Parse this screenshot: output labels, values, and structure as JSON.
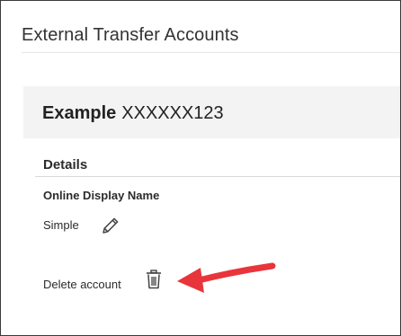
{
  "page": {
    "title": "External Transfer Accounts"
  },
  "account": {
    "name": "Example",
    "masked_number": "XXXXXX123"
  },
  "details": {
    "section_title": "Details",
    "display_name_label": "Online Display Name",
    "display_name_value": "Simple",
    "edit_icon": "pencil-icon",
    "delete_label": "Delete account",
    "delete_icon": "trash-icon"
  },
  "annotation": {
    "arrow_color": "#e8353b",
    "points_to": "delete-account-button"
  },
  "colors": {
    "header_bg": "#f3f3f3",
    "border": "#3a3a3a"
  }
}
